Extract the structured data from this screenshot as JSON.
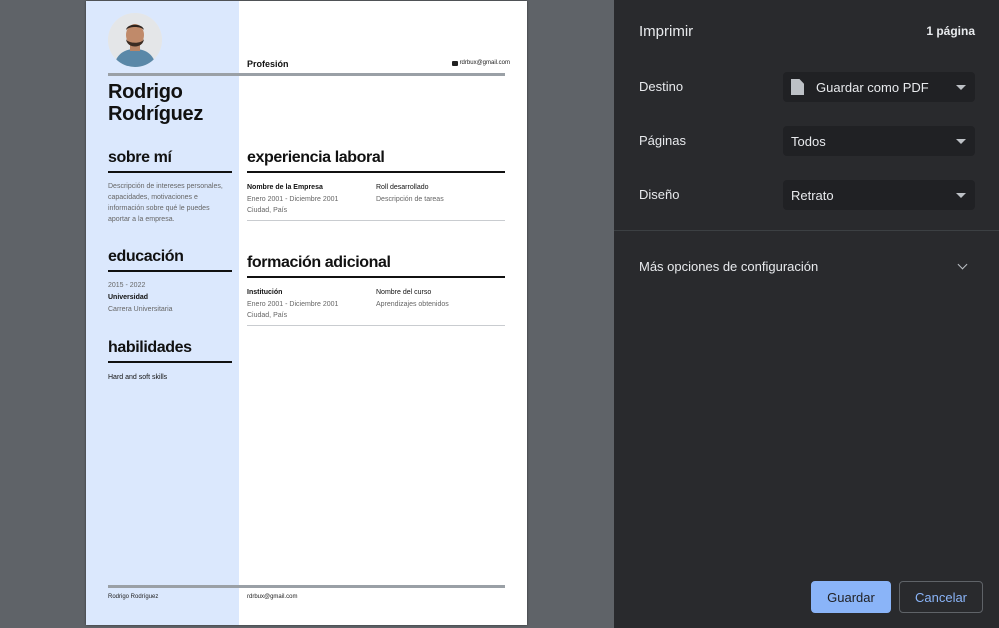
{
  "resume": {
    "name_line1": "Rodrigo",
    "name_line2": "Rodríguez",
    "profession": "Profesión",
    "email": "rdrbux@gmail.com",
    "about": {
      "title": "sobre mí",
      "lines": [
        "Descripción de intereses personales,",
        "capacidades, motivaciones e",
        "información sobre qué le puedes",
        "aportar a la empresa."
      ]
    },
    "education": {
      "title": "educación",
      "years": "2015 - 2022",
      "institution": "Universidad",
      "degree": "Carrera Universitaria"
    },
    "skills": {
      "title": "habilidades",
      "text": "Hard and soft skills"
    },
    "experience": {
      "title": "experiencia laboral",
      "company": "Nombre de la Empresa",
      "dates": "Enero 2001 - Diciembre 2001",
      "location": "Ciudad, País",
      "role": "Roll desarrollado",
      "tasks": "Descripción de tareas"
    },
    "training": {
      "title": "formación adicional",
      "institution": "Institución",
      "dates": "Enero 2001 - Diciembre 2001",
      "location": "Ciudad, País",
      "course": "Nombre del curso",
      "learnings": "Aprendizajes obtenidos"
    },
    "footer": {
      "name": "Rodrigo Rodríguez",
      "email": "rdrbux@gmail.com"
    }
  },
  "print": {
    "title": "Imprimir",
    "page_count": "1 página",
    "destination_label": "Destino",
    "destination_value": "Guardar como PDF",
    "pages_label": "Páginas",
    "pages_value": "Todos",
    "layout_label": "Diseño",
    "layout_value": "Retrato",
    "more_settings": "Más opciones de configuración",
    "save_button": "Guardar",
    "cancel_button": "Cancelar"
  },
  "colors": {
    "sidebar": "#dbe8fd",
    "panel_bg": "#292a2d",
    "accent": "#8ab4f8"
  }
}
